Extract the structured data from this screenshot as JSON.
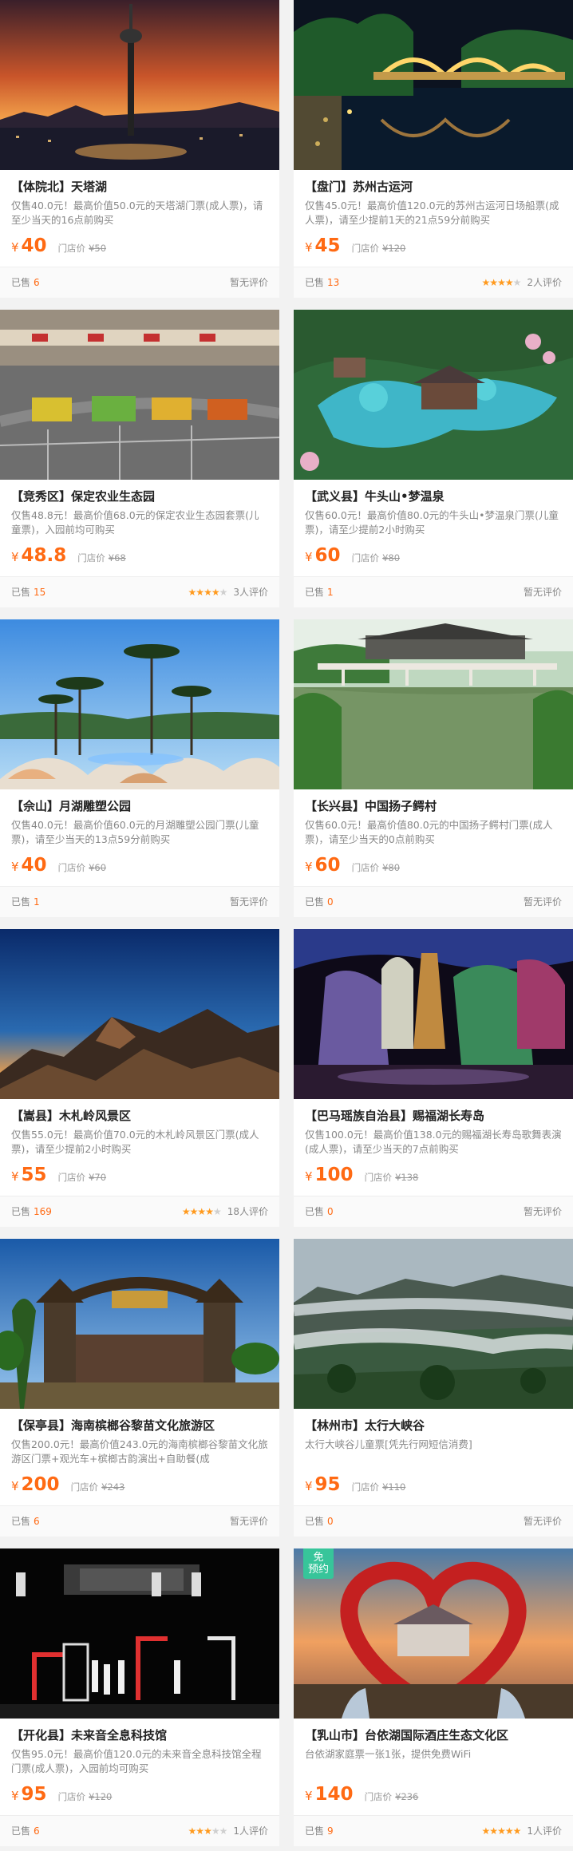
{
  "labels": {
    "shop_price": "门店价",
    "sold": "已售",
    "no_review": "暂无评价",
    "yen": "¥",
    "free_booking": "免\n预约"
  },
  "colors": {
    "accent": "#ff6a13",
    "star": "#ff9a1e",
    "badge": "#37c59a"
  },
  "items": [
    {
      "title": "【体院北】天塔湖",
      "desc": "仅售40.0元！最高价值50.0元的天塔湖门票(成人票)，请至少当天的16点前购买",
      "price": "40",
      "orig": "¥50",
      "sold": "6",
      "review": "暂无评价",
      "rating": 0,
      "image": "tv-tower-sunset"
    },
    {
      "title": "【盘门】苏州古运河",
      "desc": "仅售45.0元！最高价值120.0元的苏州古运河日场船票(成人票)，请至少提前1天的21点59分前购买",
      "price": "45",
      "orig": "¥120",
      "sold": "13",
      "review": "2人评价",
      "rating": 4.5,
      "image": "canal-night-bridge"
    },
    {
      "title": "【竞秀区】保定农业生态园",
      "desc": "仅售48.8元！最高价值68.0元的保定农业生态园套票(儿童票)，入园前均可购买",
      "price": "48.8",
      "orig": "¥68",
      "sold": "15",
      "review": "3人评价",
      "rating": 4,
      "image": "amusement-track"
    },
    {
      "title": "【武义县】牛头山•梦温泉",
      "desc": "仅售60.0元！最高价值80.0元的牛头山•梦温泉门票(儿童票)，请至少提前2小时购买",
      "price": "60",
      "orig": "¥80",
      "sold": "1",
      "review": "暂无评价",
      "rating": 0,
      "image": "hot-spring-aerial"
    },
    {
      "title": "【佘山】月湖雕塑公园",
      "desc": "仅售40.0元！最高价值60.0元的月湖雕塑公园门票(儿童票)，请至少当天的13点59分前购买",
      "price": "40",
      "orig": "¥60",
      "sold": "1",
      "review": "暂无评价",
      "rating": 0,
      "image": "sculpture-palms"
    },
    {
      "title": "【长兴县】中国扬子鳄村",
      "desc": "仅售60.0元！最高价值80.0元的中国扬子鳄村门票(成人票)，请至少当天的0点前购买",
      "price": "60",
      "orig": "¥80",
      "sold": "0",
      "review": "暂无评价",
      "rating": 0,
      "image": "lake-pavilion"
    },
    {
      "title": "【嵩县】木札岭风景区",
      "desc": "仅售55.0元！最高价值70.0元的木札岭风景区门票(成人票)，请至少提前2小时购买",
      "price": "55",
      "orig": "¥70",
      "sold": "169",
      "review": "18人评价",
      "rating": 4.5,
      "image": "mountain-dusk"
    },
    {
      "title": "【巴马瑶族自治县】赐福湖长寿岛",
      "desc": "仅售100.0元！最高价值138.0元的赐福湖长寿岛歌舞表演(成人票)，请至少当天的7点前购买",
      "price": "100",
      "orig": "¥138",
      "sold": "0",
      "review": "暂无评价",
      "rating": 0,
      "image": "colorful-cave"
    },
    {
      "title": "【保亭县】海南槟榔谷黎苗文化旅游区",
      "desc": "仅售200.0元！最高价值243.0元的海南槟榔谷黎苗文化旅游区门票+观光车+槟榔古韵演出+自助餐(成",
      "price": "200",
      "orig": "¥243",
      "sold": "6",
      "review": "暂无评价",
      "rating": 0,
      "image": "tribal-gate"
    },
    {
      "title": "【林州市】太行大峡谷",
      "desc": "太行大峡谷儿童票[凭先行网短信消费]",
      "price": "95",
      "orig": "¥110",
      "sold": "0",
      "review": "暂无评价",
      "rating": 0,
      "image": "misty-cliffs"
    },
    {
      "title": "【开化县】未来音全息科技馆",
      "desc": "仅售95.0元！最高价值120.0元的未来音全息科技馆全程门票(成人票)，入园前均可购买",
      "price": "95",
      "orig": "¥120",
      "sold": "6",
      "review": "1人评价",
      "rating": 3,
      "image": "hologram-stage"
    },
    {
      "title": "【乳山市】台依湖国际酒庄生态文化区",
      "desc": "台依湖家庭票一张1张，提供免费WiFi",
      "price": "140",
      "orig": "¥236",
      "sold": "9",
      "review": "1人评价",
      "rating": 5,
      "image": "heart-arch",
      "badge": true
    }
  ]
}
